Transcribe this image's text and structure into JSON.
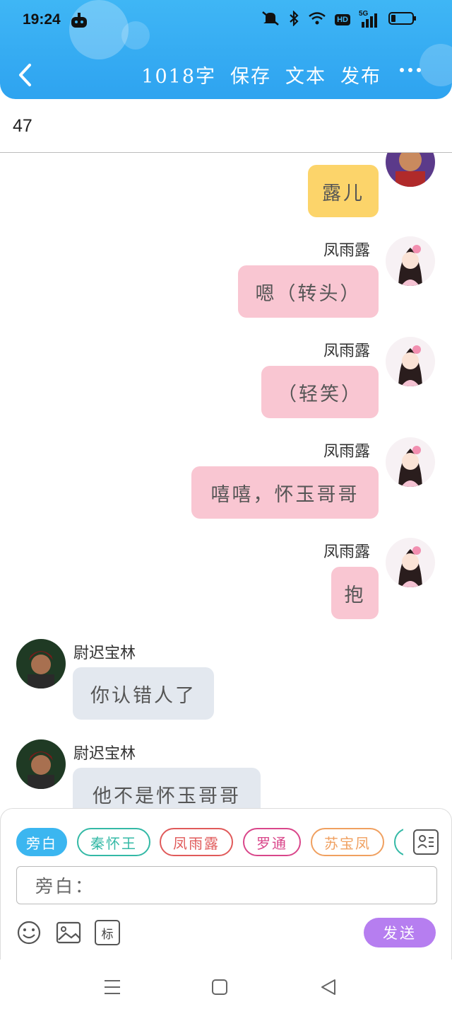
{
  "status_bar": {
    "time": "19:24",
    "icons": [
      "app-notification-icon",
      "mute-icon",
      "bluetooth-icon",
      "wifi-icon",
      "hd-icon",
      "5g-signal-icon",
      "battery-icon"
    ],
    "hd_label": "HD",
    "network_label": "5G"
  },
  "toolbar": {
    "word_count": "1018字",
    "save_label": "保存",
    "text_label": "文本",
    "publish_label": "发布",
    "back_icon": "chevron-left-icon",
    "more_icon": "more-dots-icon"
  },
  "subheader": {
    "count": "47"
  },
  "messages": [
    {
      "side": "right",
      "name": "",
      "text": "露儿",
      "bubble_color": "#fcd46a",
      "avatar": "qin-huaiyu-avatar"
    },
    {
      "side": "right",
      "name": "凤雨露",
      "text": "嗯（转头）",
      "bubble_color": "#f9c6d2",
      "avatar": "feng-yulu-avatar"
    },
    {
      "side": "right",
      "name": "凤雨露",
      "text": "（轻笑）",
      "bubble_color": "#f9c6d2",
      "avatar": "feng-yulu-avatar"
    },
    {
      "side": "right",
      "name": "凤雨露",
      "text": "嘻嘻，怀玉哥哥",
      "bubble_color": "#f9c6d2",
      "avatar": "feng-yulu-avatar"
    },
    {
      "side": "right",
      "name": "凤雨露",
      "text": "抱",
      "bubble_color": "#f9c6d2",
      "avatar": "feng-yulu-avatar"
    },
    {
      "side": "left",
      "name": "尉迟宝林",
      "text": "你认错人了",
      "bubble_color": "#e3e8ef",
      "avatar": "yuchi-baolin-avatar"
    },
    {
      "side": "left",
      "name": "尉迟宝林",
      "text": "他不是怀玉哥哥",
      "bubble_color": "#e3e8ef",
      "avatar": "yuchi-baolin-avatar"
    }
  ],
  "roles": [
    {
      "label": "旁白",
      "color": "#3bb6f0",
      "selected": true
    },
    {
      "label": "秦怀王",
      "color": "#34b9a6",
      "selected": false
    },
    {
      "label": "凤雨露",
      "color": "#e05a5a",
      "selected": false
    },
    {
      "label": "罗通",
      "color": "#d9468a",
      "selected": false
    },
    {
      "label": "苏宝凤",
      "color": "#f0a060",
      "selected": false
    }
  ],
  "input": {
    "value": "旁白："
  },
  "bottom_tools": {
    "emoji_icon": "emoji-icon",
    "image_icon": "image-icon",
    "tag_label": "标",
    "roster_icon": "contact-list-icon"
  },
  "send_label": "发送",
  "system_nav": [
    "menu-icon",
    "home-icon",
    "back-triangle-icon"
  ]
}
